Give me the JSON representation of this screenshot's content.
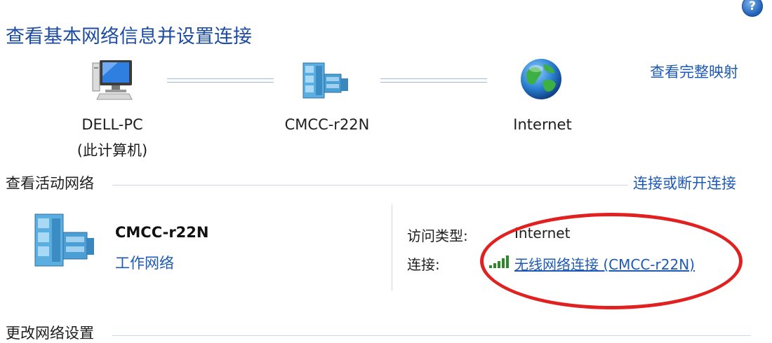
{
  "header": {
    "help_glyph": "?",
    "title": "查看基本网络信息并设置连接"
  },
  "network_map": {
    "computer": {
      "name": "DELL-PC",
      "subtitle": "(此计算机)",
      "icon": "computer-icon"
    },
    "router": {
      "name": "CMCC-r22N",
      "icon": "network-icon"
    },
    "internet": {
      "name": "Internet",
      "icon": "globe-icon"
    },
    "full_map_link": "查看完整映射"
  },
  "active_networks": {
    "section_title": "查看活动网络",
    "connect_link": "连接或断开连接",
    "network": {
      "name": "CMCC-r22N",
      "type_link": "工作网络",
      "icon": "network-icon"
    },
    "properties": {
      "access_type_label": "访问类型:",
      "access_type_value": "Internet",
      "connection_label": "连接:",
      "connection_value": "无线网络连接 (CMCC-r22N)",
      "connection_icon": "wifi-signal-icon"
    }
  },
  "change_settings": {
    "section_title": "更改网络设置"
  },
  "colors": {
    "title_blue": "#1e4ca0",
    "link_blue": "#1e5ab4",
    "highlight_red": "#e12020"
  }
}
